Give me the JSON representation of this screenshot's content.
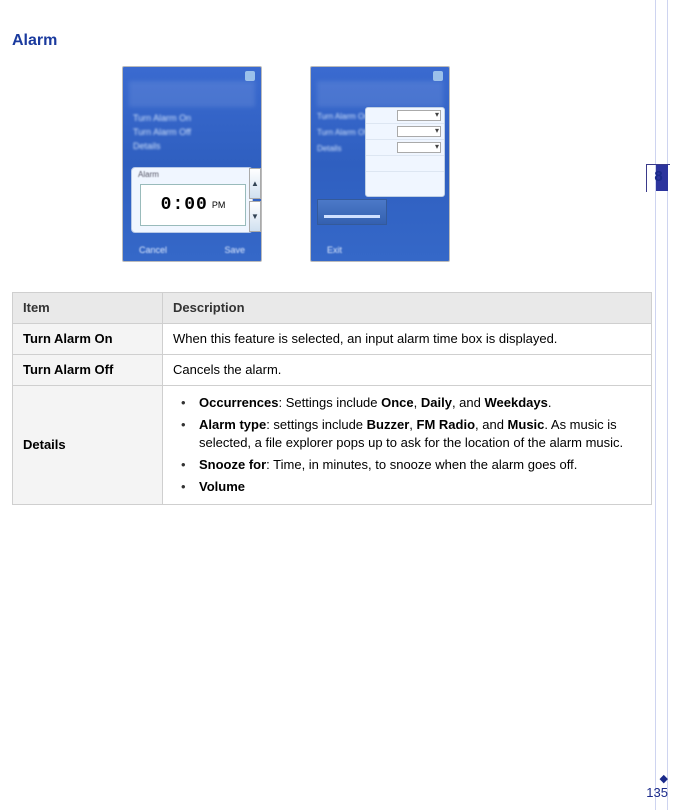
{
  "section": {
    "title": "Alarm"
  },
  "chapter": {
    "number": "8"
  },
  "page": {
    "number": "135",
    "marker": "◆"
  },
  "screenshots": {
    "left": {
      "menu1": "Turn Alarm On",
      "menu2": "Turn Alarm Off",
      "menu3": "Details",
      "widget_label": "Alarm",
      "time": "0:00",
      "ampm": "PM",
      "soft_left": "Cancel",
      "soft_right": "Save"
    },
    "right": {
      "line1": "Turn Alarm On",
      "line2": "Turn Alarm Off",
      "line3": "Details",
      "soft_left": "Exit"
    }
  },
  "table": {
    "header_item": "Item",
    "header_desc": "Description",
    "rows": [
      {
        "label": "Turn Alarm On",
        "desc": "When this feature is selected, an input alarm time box is displayed."
      },
      {
        "label": "Turn Alarm Off",
        "desc": "Cancels the alarm."
      },
      {
        "label": "Details"
      }
    ],
    "details_items": [
      {
        "label": "Occurrences",
        "text": ": Settings include ",
        "b1": "Once",
        "b2": "Daily",
        "b3": "Weekdays",
        "join": ", ",
        "and": ", and ",
        "tail": "."
      },
      {
        "label": "Alarm type",
        "text": ": settings include ",
        "b1": "Buzzer",
        "b2": "FM Radio",
        "b3": "Music",
        "join": ", ",
        "and": ", and ",
        "tail": ". As music is selected, a file explorer pops up to ask for the location of the alarm music."
      },
      {
        "label": "Snooze for",
        "text": ": Time, in minutes, to snooze when the alarm goes off."
      },
      {
        "label": "Volume",
        "text": ""
      }
    ]
  }
}
